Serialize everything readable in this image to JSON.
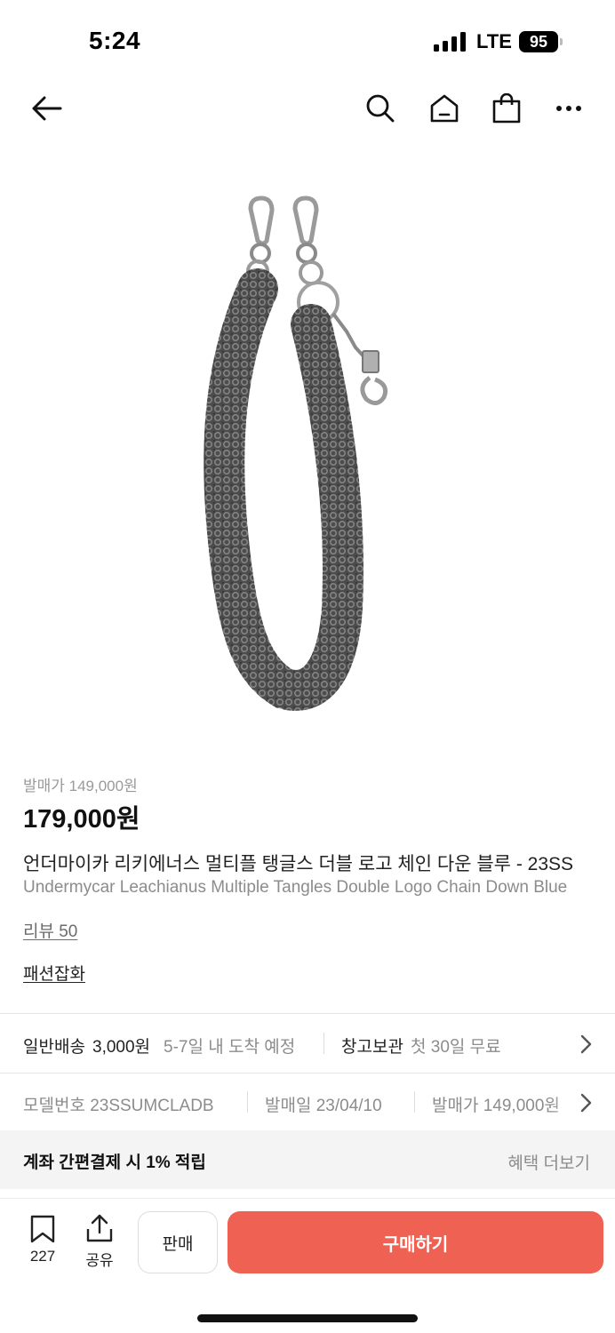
{
  "status": {
    "time": "5:24",
    "network": "LTE",
    "battery": "95"
  },
  "nav": {
    "icons": [
      "back-arrow-icon",
      "search-icon",
      "home-icon",
      "shopping-bag-icon",
      "more-icon"
    ]
  },
  "product": {
    "image_alt": "silver tangled chain wallet chain with two clasps and logo charm",
    "original_price": "발매가 149,000원",
    "price": "179,000원",
    "title_ko": "언더마이카 리키에너스 멀티플 탱글스 더블 로고 체인 다운 블루 - 23SS",
    "title_en": "Undermycar Leachianus Multiple Tangles Double Logo Chain Down Blue",
    "review": "리뷰 50",
    "store": "패션잡화"
  },
  "shipping": {
    "type": "일반배송",
    "fee": "3,000원",
    "eta": "5-7일 내 도착 예정",
    "storage_label": "창고보관",
    "storage_value": "첫 30일 무료"
  },
  "specs": {
    "model": "모델번호 23SSUMCLADB",
    "release_date": "발매일 23/04/10",
    "release_price": "발매가 149,000원"
  },
  "benefit": {
    "text": "계좌 간편결제 시 1% 적립",
    "more": "혜택 더보기"
  },
  "bottom": {
    "bookmark_count": "227",
    "share_label": "공유",
    "sell_label": "판매",
    "buy_label": "구매하기"
  },
  "colors": {
    "accent": "#ef6253",
    "text": "#222222",
    "muted": "#8c8c8c"
  }
}
